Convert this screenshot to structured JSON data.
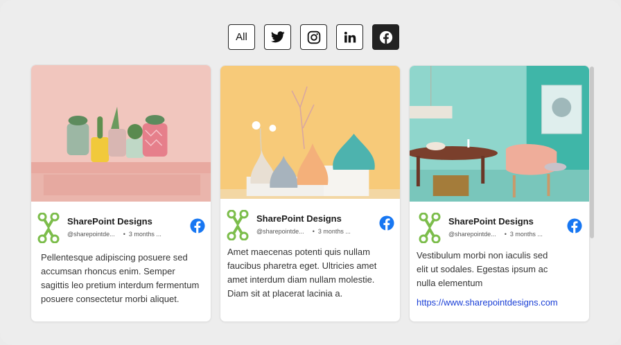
{
  "filters": [
    {
      "label": "All",
      "icon": "",
      "active": false
    },
    {
      "label": "",
      "icon": "twitter-icon",
      "active": false
    },
    {
      "label": "",
      "icon": "instagram-icon",
      "active": false
    },
    {
      "label": "",
      "icon": "linkedin-icon",
      "active": false
    },
    {
      "label": "",
      "icon": "facebook-icon",
      "active": true
    }
  ],
  "cards": [
    {
      "image": "pink shelf with potted cacti",
      "author": "SharePoint Designs",
      "handle": "@sharepointde...",
      "time": "3 months ...",
      "text": "Pellentesque adipiscing posuere sed accumsan rhoncus enim. Semper sagittis leo pretium interdum fermentum posuere consectetur morbi aliquet.",
      "link": ""
    },
    {
      "image": "ceramic vases on yellow background",
      "author": "SharePoint Designs",
      "handle": "@sharepointde...",
      "time": "3 months ...",
      "text": "Amet maecenas potenti quis nullam faucibus pharetra eget. Ultricies amet amet interdum diam nullam molestie. Diam sit at placerat lacinia a.",
      "link": ""
    },
    {
      "image": "teal room with pink chair and table",
      "author": "SharePoint Designs",
      "handle": "@sharepointde...",
      "time": "3 months ...",
      "text": "Vestibulum morbi non iaculis sed elit ut sodales. Egestas ipsum ac nulla elementum",
      "link": "https://www.sharepointdesigns.com"
    }
  ],
  "colors": {
    "facebook": "#1877f2",
    "logo_green": "#7cbd4b",
    "link": "#1a3fd6"
  }
}
